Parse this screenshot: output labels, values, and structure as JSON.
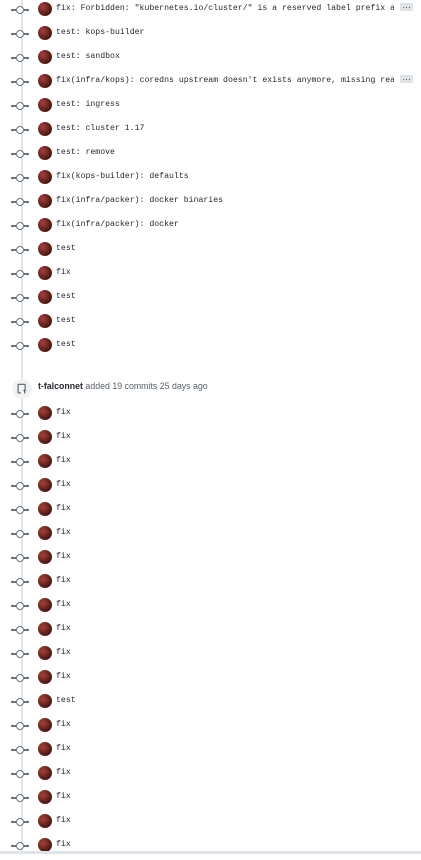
{
  "commits_before": [
    {
      "message": "fix: Forbidden: \"kubernetes.io/cluster/\" is a reserved label prefix a…",
      "has_more": true
    },
    {
      "message": "test: kops-builder",
      "has_more": false
    },
    {
      "message": "test: sandbox",
      "has_more": false
    },
    {
      "message": "fix(infra/kops): coredns upstream doesn't exists anymore, missing rea…",
      "has_more": true
    },
    {
      "message": "test: ingress",
      "has_more": false
    },
    {
      "message": "test: cluster 1.17",
      "has_more": false
    },
    {
      "message": "test: remove",
      "has_more": false
    },
    {
      "message": "fix(kops-builder): defaults",
      "has_more": false
    },
    {
      "message": "fix(infra/packer): docker binaries",
      "has_more": false
    },
    {
      "message": "fix(infra/packer): docker",
      "has_more": false
    },
    {
      "message": "test",
      "has_more": false
    },
    {
      "message": "fix",
      "has_more": false
    },
    {
      "message": "test",
      "has_more": false
    },
    {
      "message": "test",
      "has_more": false
    },
    {
      "message": "test",
      "has_more": false
    }
  ],
  "event": {
    "author": "t-falconnet",
    "action": "added 19 commits",
    "time": "25 days ago",
    "icon": "repo-push-icon"
  },
  "commits_after": [
    {
      "message": "fix"
    },
    {
      "message": "fix"
    },
    {
      "message": "fix"
    },
    {
      "message": "fix"
    },
    {
      "message": "fix"
    },
    {
      "message": "fix"
    },
    {
      "message": "fix"
    },
    {
      "message": "fix"
    },
    {
      "message": "fix"
    },
    {
      "message": "fix"
    },
    {
      "message": "fix"
    },
    {
      "message": "fix"
    },
    {
      "message": "test"
    },
    {
      "message": "fix"
    },
    {
      "message": "fix"
    },
    {
      "message": "fix"
    },
    {
      "message": "fix"
    },
    {
      "message": "fix"
    },
    {
      "message": "fix"
    }
  ],
  "ellipsis_label": "…",
  "colors": {
    "timeline": "#e1e4e8",
    "text": "#24292e",
    "muted": "#586069",
    "link": "#0366d6"
  }
}
